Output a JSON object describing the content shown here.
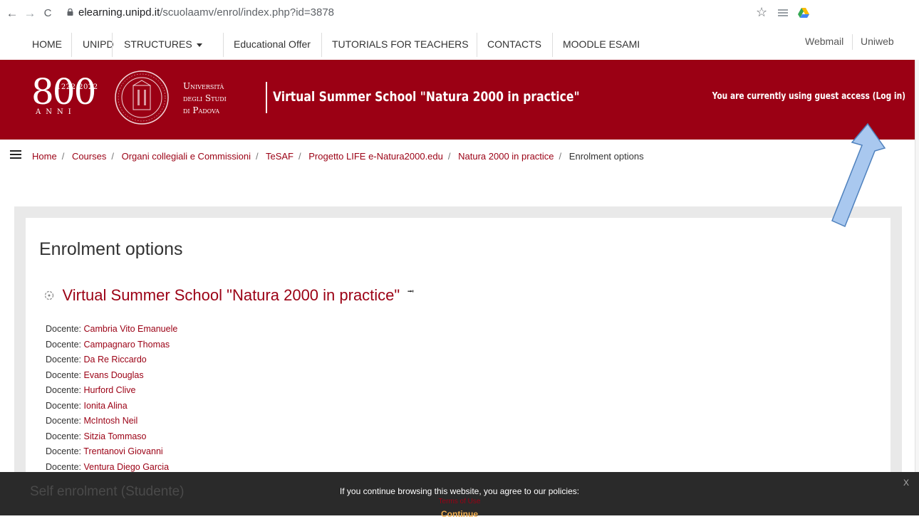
{
  "browser": {
    "back": "←",
    "forward": "→",
    "reload": "C",
    "url_host": "elearning.unipd.it",
    "url_path": "/scuolaamv/enrol/index.php?id=3878",
    "star": "☆"
  },
  "topnav": {
    "items": [
      "HOME",
      "UNIPD",
      "STRUCTURES",
      "Educational Offer",
      "TUTORIALS FOR TEACHERS",
      "CONTACTS",
      "MOODLE ESAMI"
    ],
    "right": [
      "Webmail",
      "Uniweb"
    ]
  },
  "header": {
    "logo_big": "800",
    "logo_years": "1222·2022",
    "logo_anni": "ANNI",
    "university_lines": [
      "Università",
      "degli Studi",
      "di Padova"
    ],
    "course_title": "Virtual Summer School \"Natura 2000 in practice\"",
    "guest_text": "You are currently using guest access",
    "login_link": "(Log in)",
    "brand_color": "#9b0014"
  },
  "breadcrumb": [
    "Home",
    "Courses",
    "Organi collegiali e Commissioni",
    "TeSAF",
    "Progetto LIFE e-Natura2000.edu",
    "Natura 2000 in practice",
    "Enrolment options"
  ],
  "main": {
    "heading": "Enrolment options",
    "course_name": "Virtual Summer School \"Natura 2000 in practice\"",
    "teacher_role": "Docente: ",
    "teachers": [
      "Cambria Vito Emanuele",
      "Campagnaro Thomas",
      "Da Re Riccardo",
      "Evans Douglas",
      "Hurford Clive",
      "Ionita Alina",
      "McIntosh Neil",
      "Sitzia Tommaso",
      "Trentanovi Giovanni",
      "Ventura Diego Garcia"
    ]
  },
  "cookie": {
    "behind_text": "Self enrolment (Studente)",
    "message": "If you continue browsing this website, you agree to our policies:",
    "terms": "Terms of Use",
    "continue": "Continue",
    "close": "X"
  }
}
